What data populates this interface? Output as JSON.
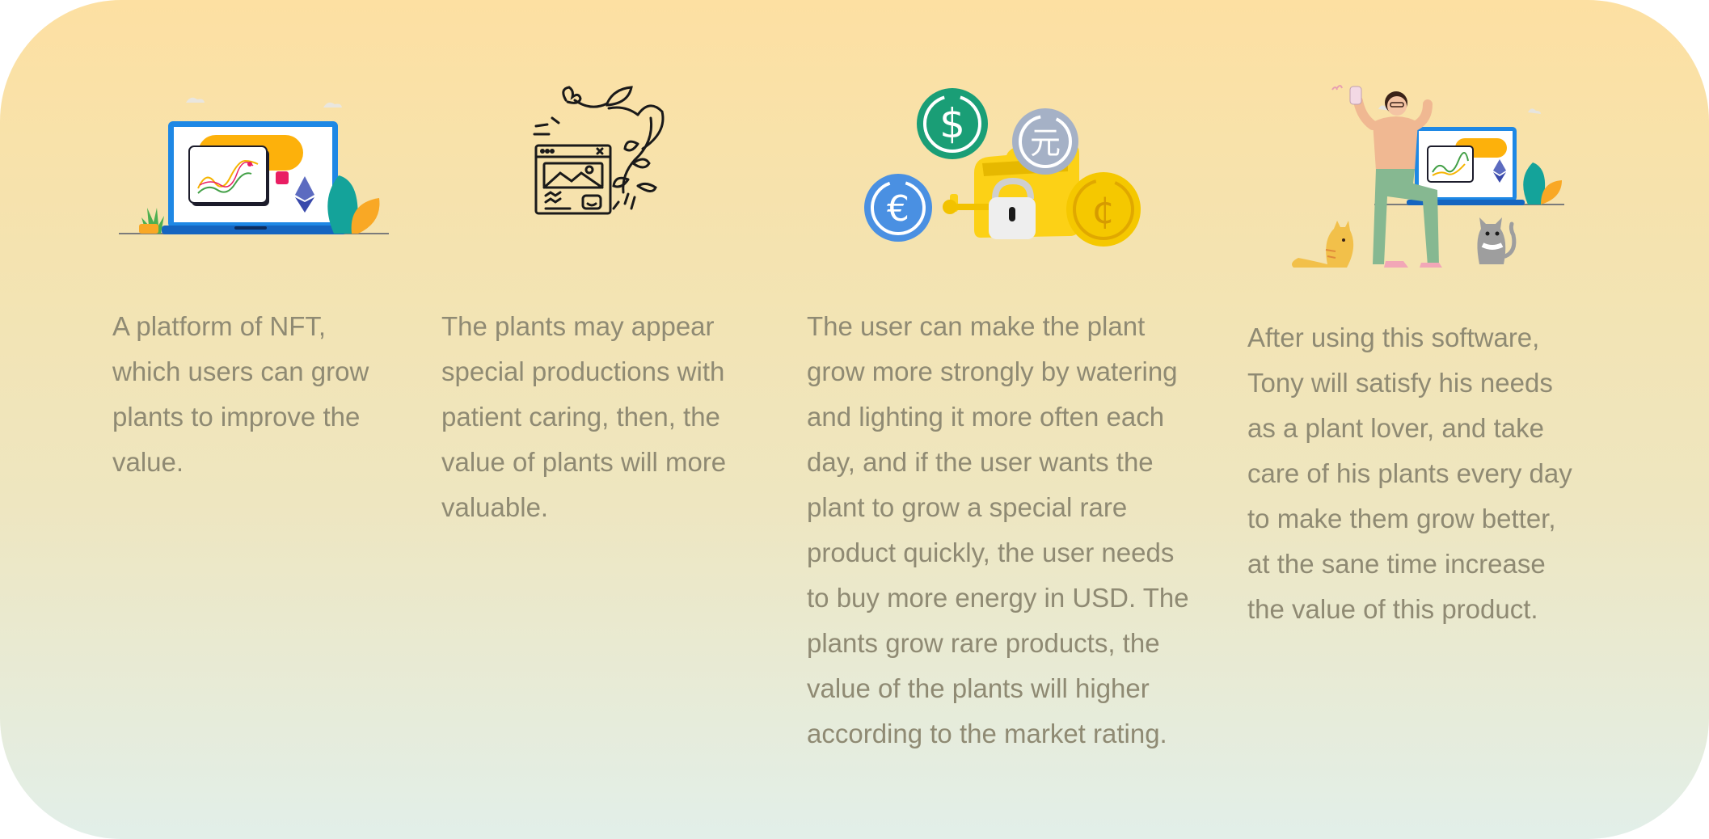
{
  "columns": [
    {
      "icon": "laptop-nft-chart-icon",
      "lines": [
        "A platform of NFT,",
        "which users can grow",
        "plants to improve the",
        "value."
      ]
    },
    {
      "icon": "plants-sketch-icon",
      "lines": [
        "The plants may appear",
        "special productions with",
        "patient caring, then, the",
        "value of plants will more",
        "valuable."
      ]
    },
    {
      "icon": "currency-coins-icon",
      "lines": [
        "The user can make the plant",
        "grow more strongly by watering",
        "and lighting it more often each",
        "day, and if the user wants the",
        "plant to grow a special rare",
        "product quickly, the user needs",
        "to buy more energy in USD. The",
        "plants grow rare products, the",
        "value of the plants will higher",
        "according to the market rating."
      ]
    },
    {
      "icon": "plant-lover-with-cats-icon",
      "lines": [
        "After using this software,",
        "Tony will satisfy his needs",
        "as a plant lover, and take",
        "care of his plants every day",
        "to make them grow better,",
        "at the sane time increase",
        "the value of this product."
      ]
    }
  ],
  "coins": {
    "dollar": "$",
    "yuan": "元",
    "euro": "€",
    "cent": "¢"
  },
  "colors": {
    "text": "#8f8a73",
    "gradient_top": "#fde0a2",
    "gradient_bottom": "#e2efe9",
    "laptop_blue": "#1e88e5",
    "coin_green": "#1a9e76",
    "coin_blue": "#4a90e2",
    "coin_grey": "#a5b1c6",
    "coin_gold": "#f5c800"
  }
}
